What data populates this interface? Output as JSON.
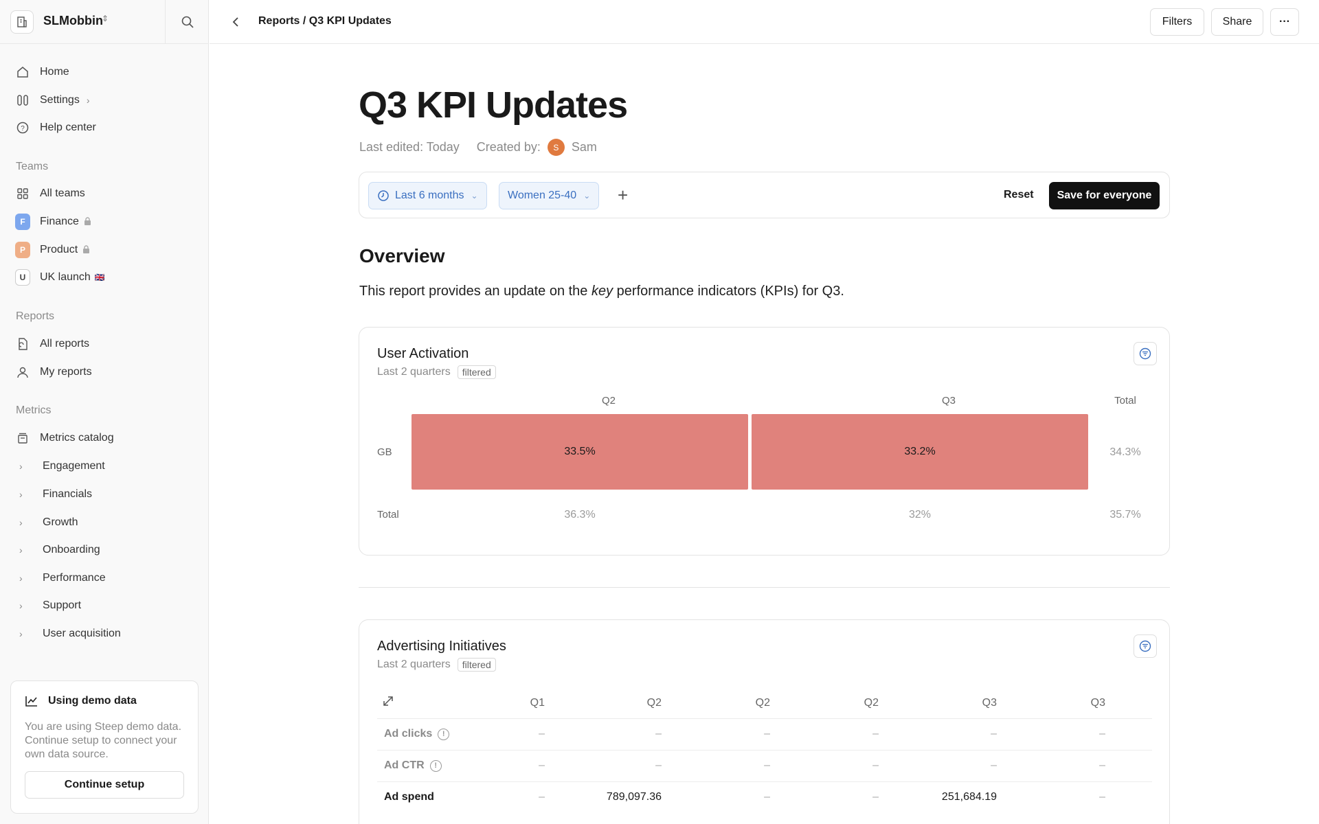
{
  "workspace": {
    "name": "SLMobbin"
  },
  "sidebar": {
    "nav": [
      {
        "label": "Home",
        "icon": "home-icon"
      },
      {
        "label": "Settings",
        "icon": "settings-icon"
      },
      {
        "label": "Help center",
        "icon": "help-icon"
      }
    ],
    "teams_label": "Teams",
    "teams": [
      {
        "label": "All teams"
      },
      {
        "label": "Finance",
        "badge": "F",
        "color": "#7da7ee"
      },
      {
        "label": "Product",
        "badge": "P",
        "color": "#efae86"
      },
      {
        "label": "UK launch",
        "badge": "U",
        "flag": "🇬🇧"
      }
    ],
    "reports_label": "Reports",
    "reports": [
      {
        "label": "All reports"
      },
      {
        "label": "My reports"
      }
    ],
    "metrics_label": "Metrics",
    "metrics_catalog": "Metrics catalog",
    "metrics": [
      "Engagement",
      "Financials",
      "Growth",
      "Onboarding",
      "Performance",
      "Support",
      "User acquisition"
    ],
    "demo": {
      "title": "Using demo data",
      "text": "You are using Steep demo data. Continue setup to connect your own data source.",
      "button": "Continue setup"
    }
  },
  "topbar": {
    "breadcrumb": "Reports / Q3 KPI Updates",
    "filters": "Filters",
    "share": "Share",
    "more": "···"
  },
  "report": {
    "title": "Q3 KPI Updates",
    "last_edited": "Last edited: Today",
    "created_by": "Created by:",
    "author_initial": "S",
    "author": "Sam",
    "filters": {
      "range": "Last 6 months",
      "segment": "Women 25-40",
      "reset": "Reset",
      "save": "Save for everyone"
    },
    "overview_heading": "Overview",
    "overview_text_pre": "This report provides an update on the ",
    "overview_text_em": "key",
    "overview_text_post": " performance indicators (KPIs) for Q3."
  },
  "user_activation": {
    "title": "User Activation",
    "subtitle": "Last 2 quarters",
    "tag": "filtered",
    "col_headers": [
      "Q2",
      "Q3",
      "Total"
    ],
    "row_gb_label": "GB",
    "row_gb": [
      "33.5%",
      "33.2%",
      "34.3%"
    ],
    "row_total_label": "Total",
    "row_total": [
      "36.3%",
      "32%",
      "35.7%"
    ]
  },
  "advertising": {
    "title": "Advertising Initiatives",
    "subtitle": "Last 2 quarters",
    "tag": "filtered",
    "columns": [
      "Q1",
      "Q2",
      "Q2",
      "Q2",
      "Q3",
      "Q3"
    ],
    "rows": [
      {
        "label": "Ad clicks",
        "info": true,
        "values": [
          "–",
          "–",
          "–",
          "–",
          "–",
          "–"
        ]
      },
      {
        "label": "Ad CTR",
        "info": true,
        "values": [
          "–",
          "–",
          "–",
          "–",
          "–",
          "–"
        ]
      },
      {
        "label": "Ad spend",
        "info": false,
        "values": [
          "–",
          "789,097.36",
          "–",
          "–",
          "251,684.19",
          "–"
        ]
      }
    ]
  }
}
